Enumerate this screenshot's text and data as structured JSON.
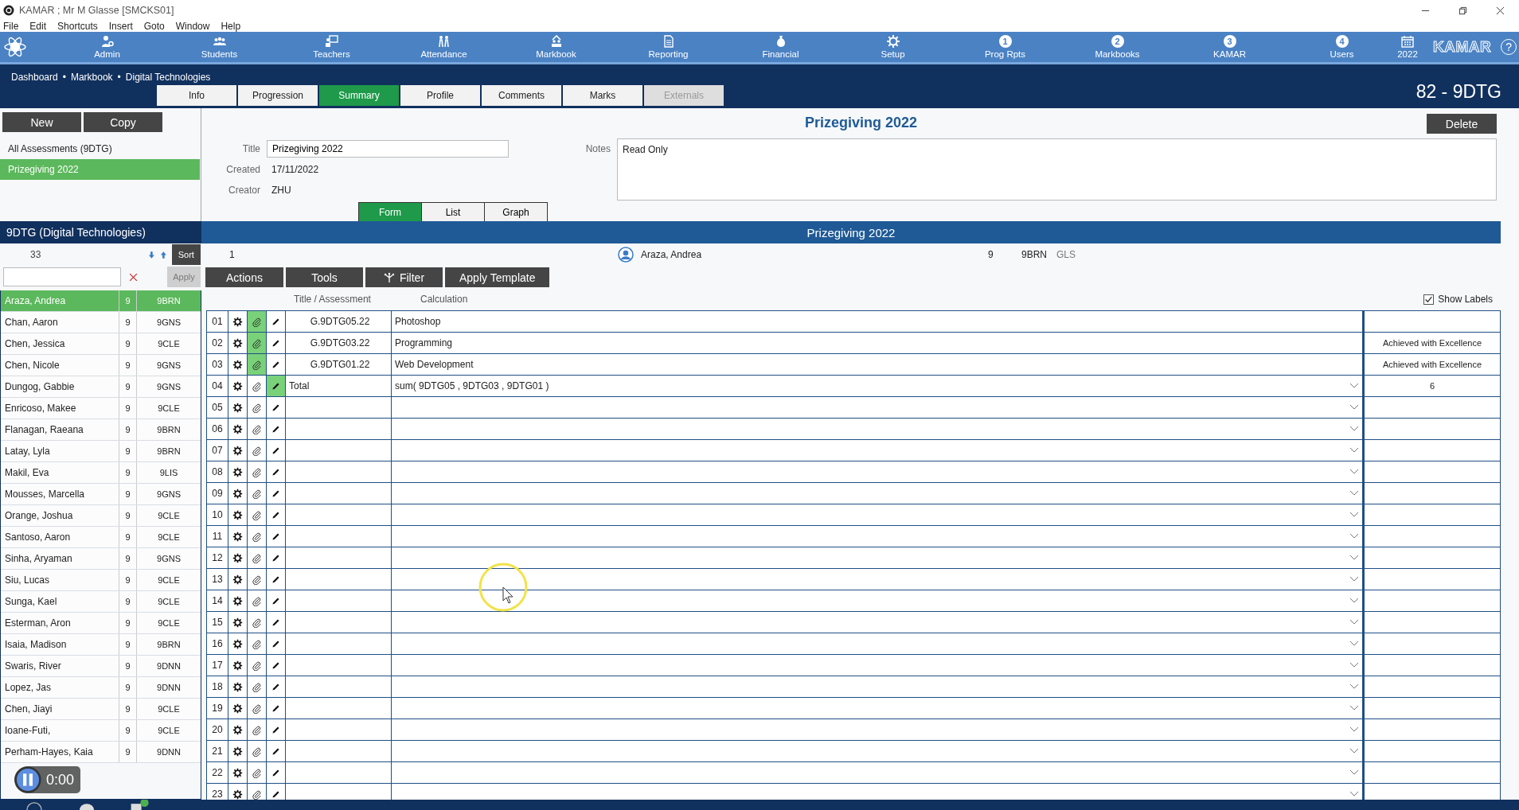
{
  "window": {
    "title": "KAMAR ; Mr M Glasse  [SMCKS01]"
  },
  "menu": [
    "File",
    "Edit",
    "Shortcuts",
    "Insert",
    "Goto",
    "Window",
    "Help"
  ],
  "nav": {
    "items": [
      {
        "label": "Admin",
        "kind": "icon"
      },
      {
        "label": "Students",
        "kind": "icon"
      },
      {
        "label": "Teachers",
        "kind": "icon"
      },
      {
        "label": "Attendance",
        "kind": "icon"
      },
      {
        "label": "Markbook",
        "kind": "icon"
      },
      {
        "label": "Reporting",
        "kind": "icon"
      },
      {
        "label": "Financial",
        "kind": "icon"
      },
      {
        "label": "Setup",
        "kind": "icon"
      },
      {
        "label": "Prog Rpts",
        "kind": "number",
        "number": "1"
      },
      {
        "label": "Markbooks",
        "kind": "number",
        "number": "2"
      },
      {
        "label": "KAMAR",
        "kind": "number",
        "number": "3"
      },
      {
        "label": "Users",
        "kind": "number",
        "number": "4"
      },
      {
        "label": "2022",
        "kind": "calendar"
      }
    ],
    "brand": "KAMAR",
    "help": "?"
  },
  "breadcrumb": {
    "separator": "•",
    "items": [
      "Dashboard",
      "Markbook",
      "Digital Technologies"
    ]
  },
  "tabs": [
    {
      "label": "Info",
      "selected": false,
      "disabled": false
    },
    {
      "label": "Progression",
      "selected": false,
      "disabled": false
    },
    {
      "label": "Summary",
      "selected": true,
      "disabled": false
    },
    {
      "label": "Profile",
      "selected": false,
      "disabled": false
    },
    {
      "label": "Comments",
      "selected": false,
      "disabled": false
    },
    {
      "label": "Marks",
      "selected": false,
      "disabled": false
    },
    {
      "label": "Externals",
      "selected": false,
      "disabled": true
    }
  ],
  "class_code": "82 - 9DTG",
  "assessments": {
    "buttons": [
      "New",
      "Copy"
    ],
    "items": [
      {
        "label": "All Assessments  (9DTG)",
        "selected": false
      },
      {
        "label": "Prizegiving 2022",
        "selected": true
      }
    ]
  },
  "form": {
    "heading": "Prizegiving 2022",
    "delete": "Delete",
    "fields": [
      {
        "label": "Title",
        "kind": "input",
        "value": "Prizegiving 2022"
      },
      {
        "label": "Created",
        "kind": "text",
        "value": "17/11/2022"
      },
      {
        "label": "Creator",
        "kind": "text",
        "value": "ZHU"
      }
    ],
    "notes": {
      "label": "Notes",
      "value": "Read Only"
    },
    "views": [
      {
        "label": "Form",
        "selected": true
      },
      {
        "label": "List",
        "selected": false
      },
      {
        "label": "Graph",
        "selected": false
      }
    ]
  },
  "class_panel": {
    "title": "9DTG (Digital Technologies)",
    "count": "33",
    "sort": "Sort",
    "apply": {
      "label": "Apply",
      "disabled": true
    },
    "students": [
      {
        "name": "Araza, Andrea",
        "year": "9",
        "form": "9BRN",
        "selected": true
      },
      {
        "name": "Chan, Aaron",
        "year": "9",
        "form": "9GNS",
        "selected": false
      },
      {
        "name": "Chen, Jessica",
        "year": "9",
        "form": "9CLE",
        "selected": false
      },
      {
        "name": "Chen, Nicole",
        "year": "9",
        "form": "9GNS",
        "selected": false
      },
      {
        "name": "Dungog, Gabbie",
        "year": "9",
        "form": "9GNS",
        "selected": false
      },
      {
        "name": "Enricoso, Makee",
        "year": "9",
        "form": "9CLE",
        "selected": false
      },
      {
        "name": "Flanagan, Raeana",
        "year": "9",
        "form": "9BRN",
        "selected": false
      },
      {
        "name": "Latay, Lyla",
        "year": "9",
        "form": "9BRN",
        "selected": false
      },
      {
        "name": "Makil, Eva",
        "year": "9",
        "form": "9LIS",
        "selected": false
      },
      {
        "name": "Mousses, Marcella",
        "year": "9",
        "form": "9GNS",
        "selected": false
      },
      {
        "name": "Orange, Joshua",
        "year": "9",
        "form": "9CLE",
        "selected": false
      },
      {
        "name": "Santoso, Aaron",
        "year": "9",
        "form": "9CLE",
        "selected": false
      },
      {
        "name": "Sinha, Aryaman",
        "year": "9",
        "form": "9GNS",
        "selected": false
      },
      {
        "name": "Siu, Lucas",
        "year": "9",
        "form": "9CLE",
        "selected": false
      },
      {
        "name": "Sunga, Kael",
        "year": "9",
        "form": "9CLE",
        "selected": false
      },
      {
        "name": "Esterman, Aron",
        "year": "9",
        "form": "9CLE",
        "selected": false
      },
      {
        "name": "Isaia, Madison",
        "year": "9",
        "form": "9BRN",
        "selected": false
      },
      {
        "name": "Swaris, River",
        "year": "9",
        "form": "9DNN",
        "selected": false
      },
      {
        "name": "Lopez, Jas",
        "year": "9",
        "form": "9DNN",
        "selected": false
      },
      {
        "name": "Chen, Jiayi",
        "year": "9",
        "form": "9CLE",
        "selected": false
      },
      {
        "name": "Ioane-Futi,",
        "year": "9",
        "form": "9CLE",
        "selected": false
      },
      {
        "name": "Perham-Hayes, Kaia",
        "year": "9",
        "form": "9DNN",
        "selected": false
      }
    ]
  },
  "markbook": {
    "title": "Prizegiving 2022",
    "student": {
      "index": "1",
      "name": "Araza, Andrea",
      "year": "9",
      "form": "9BRN",
      "code": "GLS"
    },
    "buttons": [
      {
        "label": "Actions",
        "kind": "plain"
      },
      {
        "label": "Tools",
        "kind": "plain"
      },
      {
        "label": "Filter",
        "kind": "filter"
      },
      {
        "label": "Apply Template",
        "kind": "plain"
      }
    ],
    "columns": [
      "Title / Assessment",
      "Calculation"
    ],
    "show_labels": {
      "label": "Show Labels",
      "checked": true
    },
    "rows": [
      {
        "number": "01",
        "kind": "assessment",
        "title": "G.9DTG05.22",
        "calculation": "Photoshop",
        "attachment_active": true,
        "edit_active": false,
        "dropdown": false
      },
      {
        "number": "02",
        "kind": "assessment",
        "title": "G.9DTG03.22",
        "calculation": "Programming",
        "result": "Achieved with Excellence",
        "attachment_active": true,
        "edit_active": false,
        "dropdown": false
      },
      {
        "number": "03",
        "kind": "assessment",
        "title": "G.9DTG01.22",
        "calculation": "Web Development",
        "result": "Achieved with Excellence",
        "attachment_active": true,
        "edit_active": false,
        "dropdown": false
      },
      {
        "number": "04",
        "kind": "total",
        "title": "Total",
        "calculation": "sum( 9DTG05 , 9DTG03 , 9DTG01 )",
        "result": "6",
        "attachment_active": false,
        "edit_active": true,
        "dropdown": true
      },
      {
        "number": "05",
        "kind": "empty",
        "attachment_active": false,
        "edit_active": false,
        "dropdown": true
      },
      {
        "number": "06",
        "kind": "empty",
        "attachment_active": false,
        "edit_active": false,
        "dropdown": true
      },
      {
        "number": "07",
        "kind": "empty",
        "attachment_active": false,
        "edit_active": false,
        "dropdown": true
      },
      {
        "number": "08",
        "kind": "empty",
        "attachment_active": false,
        "edit_active": false,
        "dropdown": true
      },
      {
        "number": "09",
        "kind": "empty",
        "attachment_active": false,
        "edit_active": false,
        "dropdown": true
      },
      {
        "number": "10",
        "kind": "empty",
        "attachment_active": false,
        "edit_active": false,
        "dropdown": true
      },
      {
        "number": "11",
        "kind": "empty",
        "attachment_active": false,
        "edit_active": false,
        "dropdown": true
      },
      {
        "number": "12",
        "kind": "empty",
        "attachment_active": false,
        "edit_active": false,
        "dropdown": true
      },
      {
        "number": "13",
        "kind": "empty",
        "attachment_active": false,
        "edit_active": false,
        "dropdown": true
      },
      {
        "number": "14",
        "kind": "empty",
        "attachment_active": false,
        "edit_active": false,
        "dropdown": true
      },
      {
        "number": "15",
        "kind": "empty",
        "attachment_active": false,
        "edit_active": false,
        "dropdown": true
      },
      {
        "number": "16",
        "kind": "empty",
        "attachment_active": false,
        "edit_active": false,
        "dropdown": true
      },
      {
        "number": "17",
        "kind": "empty",
        "attachment_active": false,
        "edit_active": false,
        "dropdown": true
      },
      {
        "number": "18",
        "kind": "empty",
        "attachment_active": false,
        "edit_active": false,
        "dropdown": true
      },
      {
        "number": "19",
        "kind": "empty",
        "attachment_active": false,
        "edit_active": false,
        "dropdown": true
      },
      {
        "number": "20",
        "kind": "empty",
        "attachment_active": false,
        "edit_active": false,
        "dropdown": true
      },
      {
        "number": "21",
        "kind": "empty",
        "attachment_active": false,
        "edit_active": false,
        "dropdown": true
      },
      {
        "number": "22",
        "kind": "empty",
        "attachment_active": false,
        "edit_active": false,
        "dropdown": true
      },
      {
        "number": "23",
        "kind": "empty",
        "attachment_active": false,
        "edit_active": false,
        "dropdown": true
      }
    ]
  },
  "recorder": {
    "time": "0:00"
  }
}
